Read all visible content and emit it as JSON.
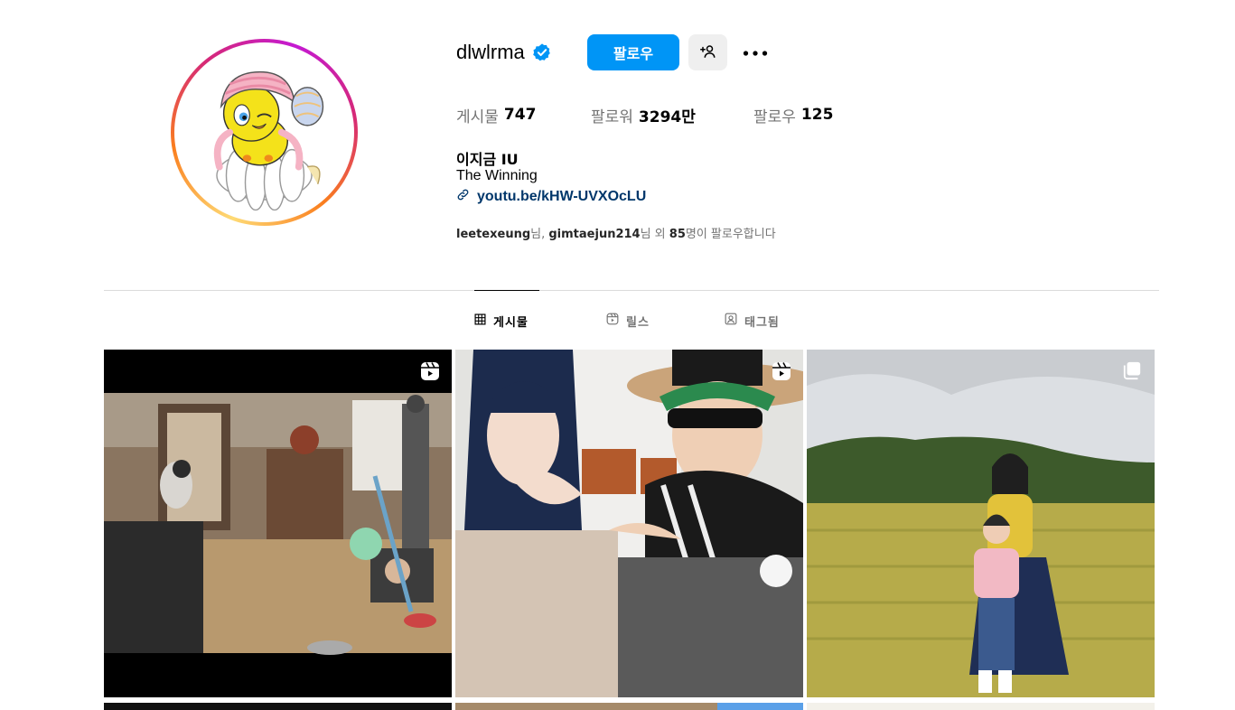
{
  "profile": {
    "username": "dlwlrma",
    "verified": true,
    "follow_label": "팔로우",
    "suggest_icon": "add-person-icon",
    "more_icon": "ellipsis-icon",
    "avatar_alt": "profile picture"
  },
  "stats": {
    "posts_label": "게시물",
    "posts_value": "747",
    "followers_label": "팔로워",
    "followers_value": "3294만",
    "following_label": "팔로우",
    "following_value": "125"
  },
  "bio": {
    "full_name": "이지금 IU",
    "text": "The Winning",
    "link": "youtu.be/kHW-UVXOcLU",
    "followed_by_user1": "leetexeung",
    "followed_by_sep1": "님, ",
    "followed_by_user2": "gimtaejun214",
    "followed_by_mid": "님 외 ",
    "followed_by_count": "85",
    "followed_by_tail": "명이 팔로우합니다"
  },
  "tabs": [
    {
      "label": "게시물",
      "icon": "grid-icon",
      "active": true
    },
    {
      "label": "릴스",
      "icon": "reels-icon",
      "active": false
    },
    {
      "label": "태그됨",
      "icon": "tagged-icon",
      "active": false
    }
  ],
  "posts": [
    {
      "type": "reel",
      "badge_icon": "reels-badge-icon"
    },
    {
      "type": "reel",
      "badge_icon": "reels-badge-icon"
    },
    {
      "type": "carousel",
      "badge_icon": "carousel-badge-icon"
    }
  ],
  "colors": {
    "primary": "#0095f6",
    "link": "#00376b",
    "secondary_text": "#737373",
    "divider": "#dbdbdb"
  }
}
